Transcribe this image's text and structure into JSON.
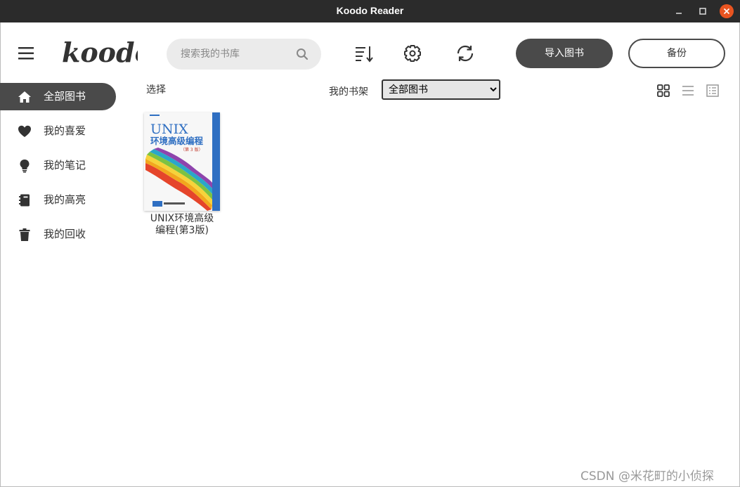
{
  "window": {
    "title": "Koodo Reader"
  },
  "header": {
    "logo_text": "koodo",
    "search": {
      "placeholder": "搜索我的书库",
      "value": ""
    },
    "import_label": "导入图书",
    "backup_label": "备份"
  },
  "sidebar": {
    "items": [
      {
        "label": "全部图书",
        "icon": "home-icon",
        "active": true
      },
      {
        "label": "我的喜爱",
        "icon": "heart-icon",
        "active": false
      },
      {
        "label": "我的笔记",
        "icon": "lightbulb-icon",
        "active": false
      },
      {
        "label": "我的高亮",
        "icon": "notebook-icon",
        "active": false
      },
      {
        "label": "我的回收",
        "icon": "trash-icon",
        "active": false
      }
    ]
  },
  "toolbar": {
    "select_label": "选择",
    "shelf_label": "我的书架",
    "shelf_selected": "全部图书"
  },
  "books": [
    {
      "title_line1": "UNIX环境高级",
      "title_line2": "编程(第3版)",
      "cover_title": "UNIX",
      "cover_subtitle": "环境高级编程",
      "cover_edition": "（第 3 版）"
    }
  ],
  "watermark": "CSDN @米花町的小侦探",
  "colors": {
    "titlebar": "#2b2b2b",
    "accent_dark": "#4a4a4a",
    "close": "#e95420"
  }
}
